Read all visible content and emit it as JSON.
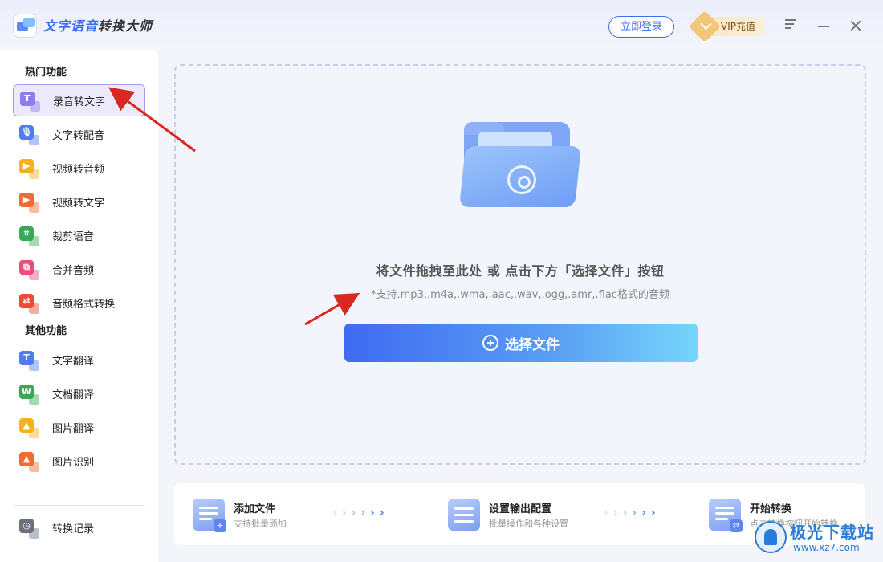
{
  "app": {
    "title_blue": "文字语音",
    "title_dark": "转换大师",
    "login_label": "立即登录",
    "vip_label": "VIP充值"
  },
  "sidebar": {
    "hot_title": "热门功能",
    "other_title": "其他功能",
    "hot_items": [
      {
        "label": "录音转文字",
        "icon": "mic-to-text-icon",
        "glyph": "T",
        "color": "#8b7cf0",
        "active": true
      },
      {
        "label": "文字转配音",
        "icon": "text-to-voice-icon",
        "glyph": "🎙",
        "color": "#4f7cf0"
      },
      {
        "label": "视频转音频",
        "icon": "video-to-audio-icon",
        "glyph": "▶",
        "color": "#f6b21a"
      },
      {
        "label": "视频转文字",
        "icon": "video-to-text-icon",
        "glyph": "▶",
        "color": "#f46a32"
      },
      {
        "label": "裁剪语音",
        "icon": "crop-audio-icon",
        "glyph": "⌗",
        "color": "#3aa856"
      },
      {
        "label": "合并音频",
        "icon": "merge-audio-icon",
        "glyph": "⧉",
        "color": "#ee4c7a"
      },
      {
        "label": "音频格式转换",
        "icon": "audio-format-icon",
        "glyph": "⇄",
        "color": "#ee4a3a"
      }
    ],
    "other_items": [
      {
        "label": "文字翻译",
        "icon": "text-translate-icon",
        "glyph": "T",
        "color": "#4f7cf0"
      },
      {
        "label": "文档翻译",
        "icon": "doc-translate-icon",
        "glyph": "W",
        "color": "#3aa856"
      },
      {
        "label": "图片翻译",
        "icon": "image-translate-icon",
        "glyph": "▲",
        "color": "#f6b21a"
      },
      {
        "label": "图片识别",
        "icon": "image-recognize-icon",
        "glyph": "▲",
        "color": "#f46a32"
      }
    ],
    "history_label": "转换记录"
  },
  "dropzone": {
    "main_text": "将文件拖拽至此处 或 点击下方「选择文件」按钮",
    "sub_text": "*支持.mp3,.m4a,.wma,.aac,.wav,.ogg,.amr,.flac格式的音频",
    "button_label": "选择文件"
  },
  "steps": [
    {
      "title": "添加文件",
      "desc": "支持批量添加"
    },
    {
      "title": "设置输出配置",
      "desc": "批量操作和各种设置"
    },
    {
      "title": "开始转换",
      "desc": "点击转换按钮开始转换"
    }
  ],
  "watermark": {
    "text": "极光下载站",
    "url": "www.xz7.com"
  }
}
